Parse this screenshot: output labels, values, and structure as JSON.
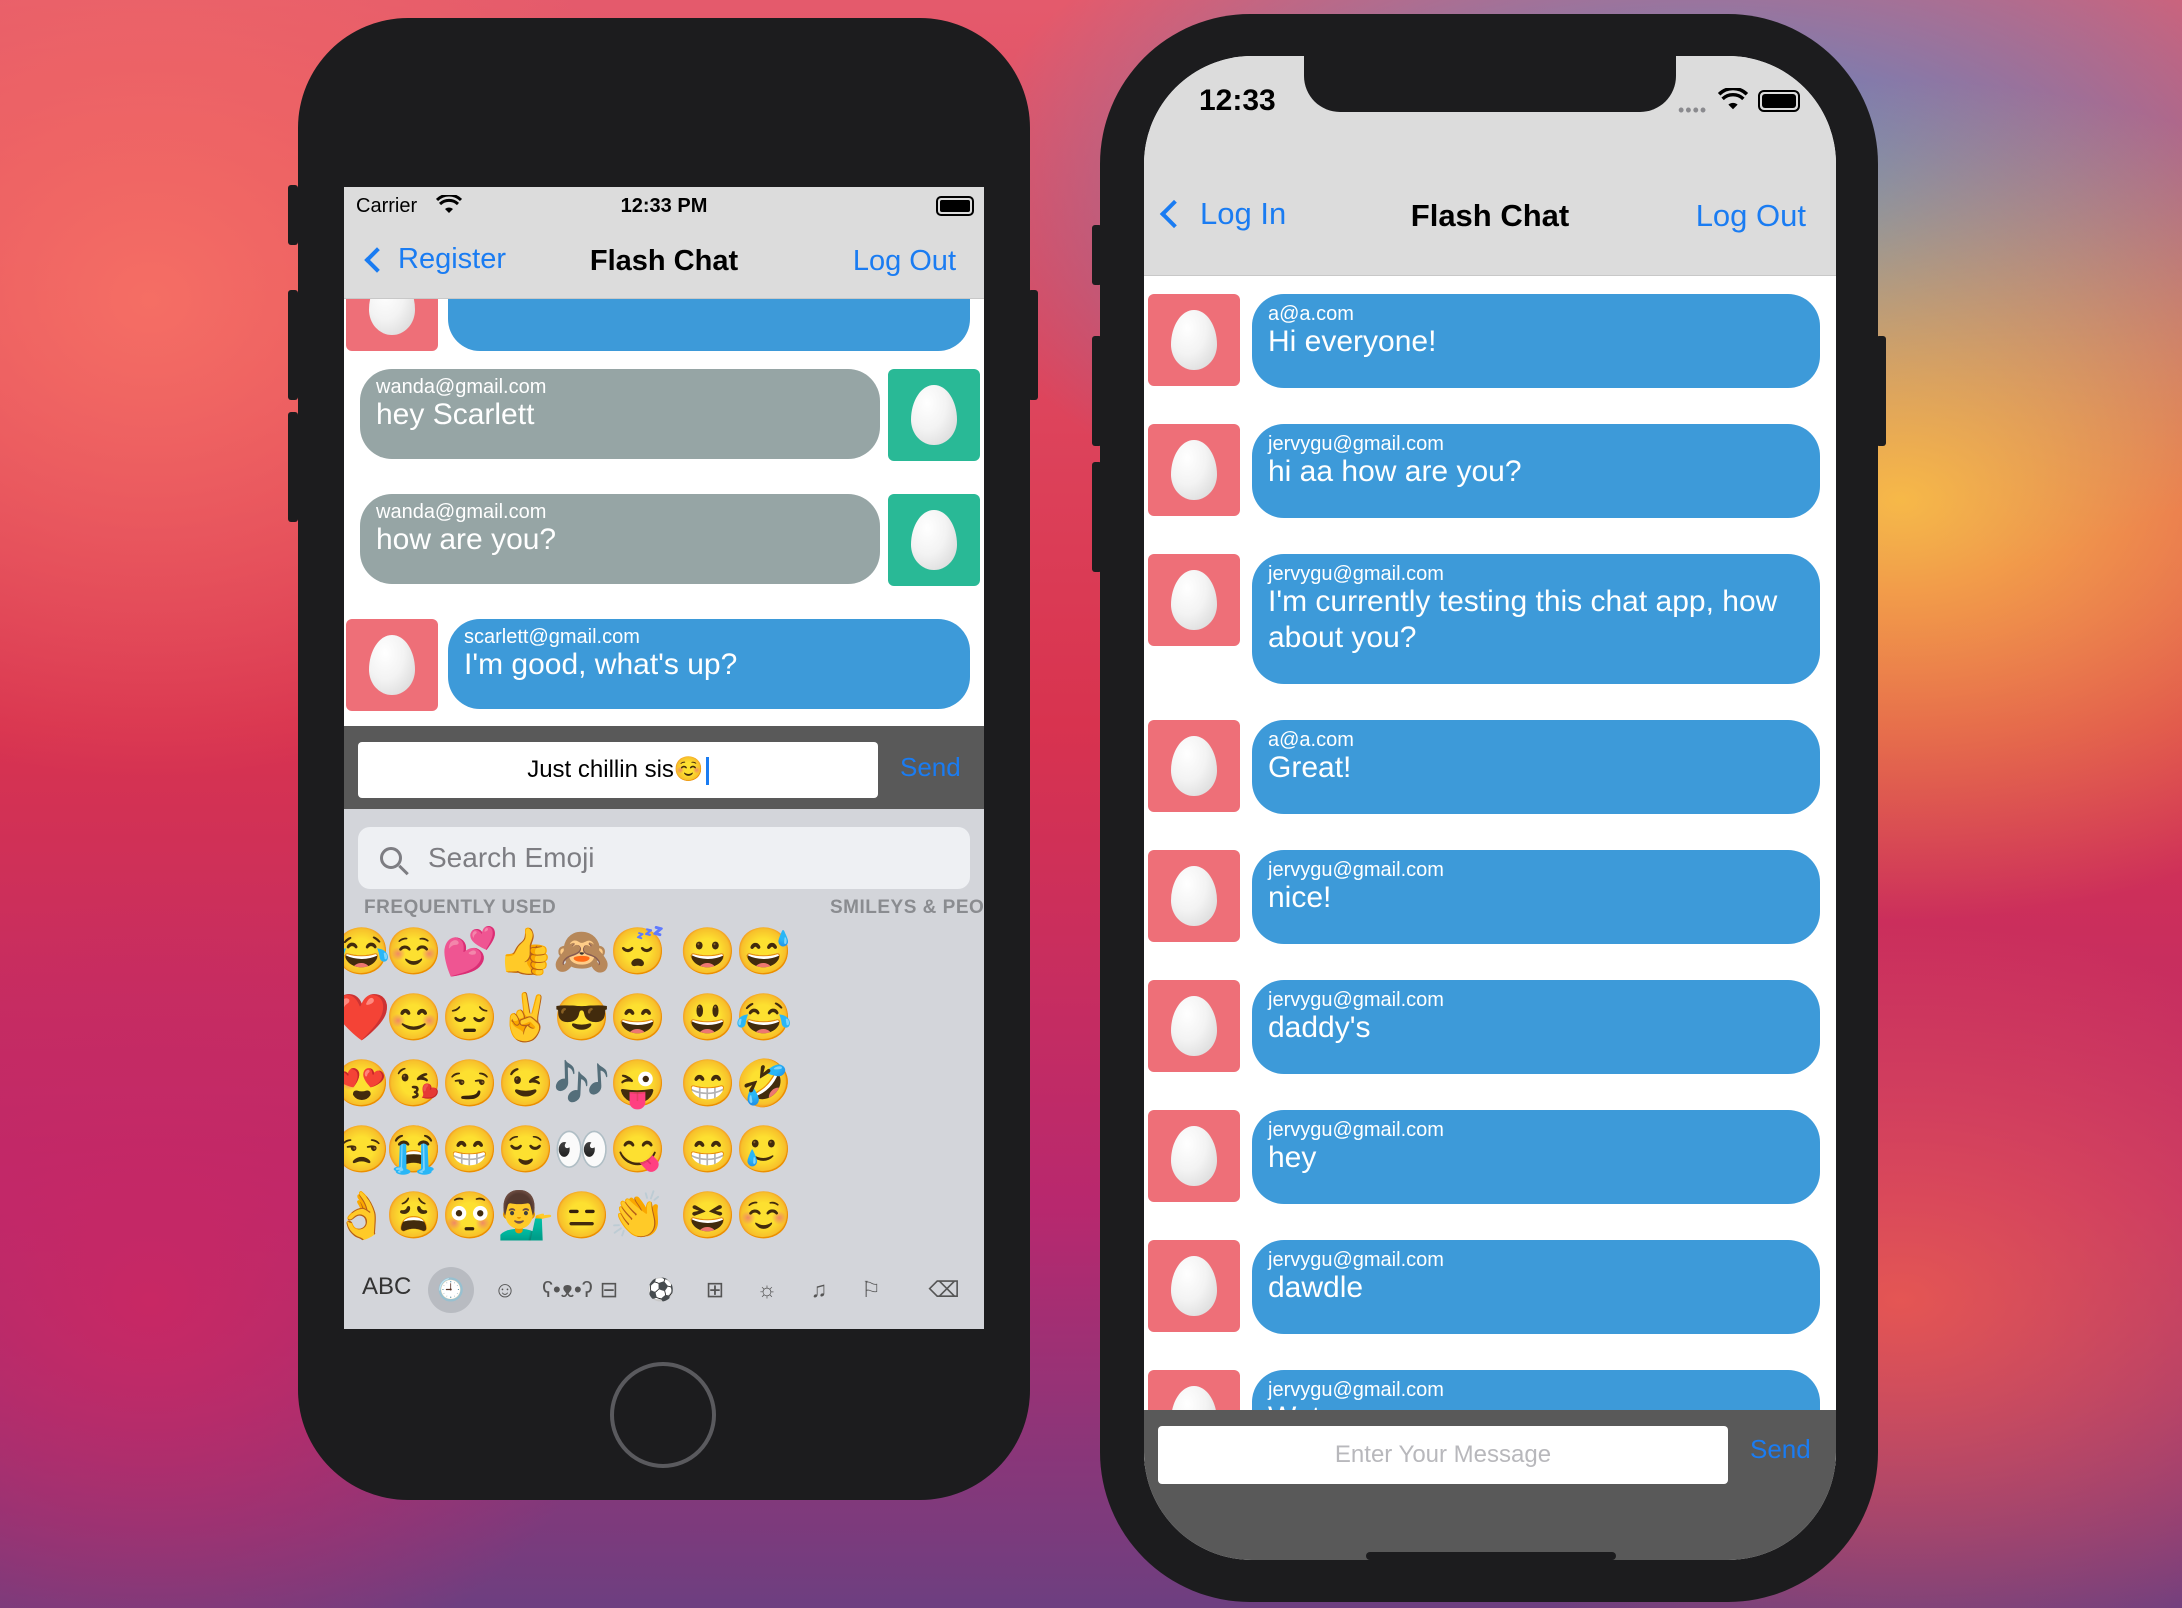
{
  "left_phone": {
    "status": {
      "carrier": "Carrier",
      "time": "12:33 PM"
    },
    "nav": {
      "back": "Register",
      "title": "Flash Chat",
      "right": "Log Out"
    },
    "messages": [
      {
        "sender": "wanda@gmail.com",
        "text": "hey Scarlett",
        "side": "right"
      },
      {
        "sender": "wanda@gmail.com",
        "text": "how are you?",
        "side": "right"
      },
      {
        "sender": "scarlett@gmail.com",
        "text": "I'm good, what's up?",
        "side": "left"
      }
    ],
    "input": {
      "value": "Just chillin sis☺️",
      "send": "Send"
    },
    "emoji_keyboard": {
      "search_placeholder": "Search Emoji",
      "section_frequent": "FREQUENTLY USED",
      "section_smileys": "SMILEYS & PEO",
      "abc": "ABC",
      "emojis": [
        [
          "😂",
          "☺️",
          "💕",
          "👍",
          "🙈",
          "😴",
          "😀",
          "😅"
        ],
        [
          "❤️",
          "😊",
          "😔",
          "✌️",
          "😎",
          "😄",
          "😃",
          "😂"
        ],
        [
          "😍",
          "😘",
          "😏",
          "😉",
          "🎶",
          "😜",
          "😁",
          "🤣"
        ],
        [
          "😒",
          "😭",
          "😁",
          "😌",
          "👀",
          "😋",
          "😁",
          "🥲"
        ],
        [
          "👌",
          "😩",
          "😳",
          "💁‍♂️",
          "😑",
          "👏",
          "😆",
          "☺️"
        ]
      ],
      "category_icons": [
        "clock-icon",
        "smiley-icon",
        "bear-icon",
        "food-icon",
        "ball-icon",
        "car-icon",
        "bulb-icon",
        "symbols-icon",
        "flag-icon",
        "delete-icon"
      ]
    }
  },
  "right_phone": {
    "status": {
      "time": "12:33"
    },
    "nav": {
      "back": "Log In",
      "title": "Flash Chat",
      "right": "Log Out"
    },
    "messages": [
      {
        "sender": "a@a.com",
        "text": "Hi everyone!"
      },
      {
        "sender": "jervygu@gmail.com",
        "text": "hi aa how are you?"
      },
      {
        "sender": "jervygu@gmail.com",
        "text": "I'm currently testing this chat app, how about you?"
      },
      {
        "sender": "a@a.com",
        "text": "Great!"
      },
      {
        "sender": "jervygu@gmail.com",
        "text": "nice!"
      },
      {
        "sender": "jervygu@gmail.com",
        "text": "daddy's"
      },
      {
        "sender": "jervygu@gmail.com",
        "text": "hey"
      },
      {
        "sender": "jervygu@gmail.com",
        "text": "dawdle"
      },
      {
        "sender": "jervygu@gmail.com",
        "text": "Wat"
      }
    ],
    "input": {
      "placeholder": "Enter Your Message",
      "send": "Send"
    }
  },
  "colors": {
    "bubble_blue": "#3d9ad9",
    "bubble_gray": "#96a5a5",
    "avatar_me": "#ee6f78",
    "avatar_you": "#29b996",
    "link": "#1a7cf2"
  }
}
